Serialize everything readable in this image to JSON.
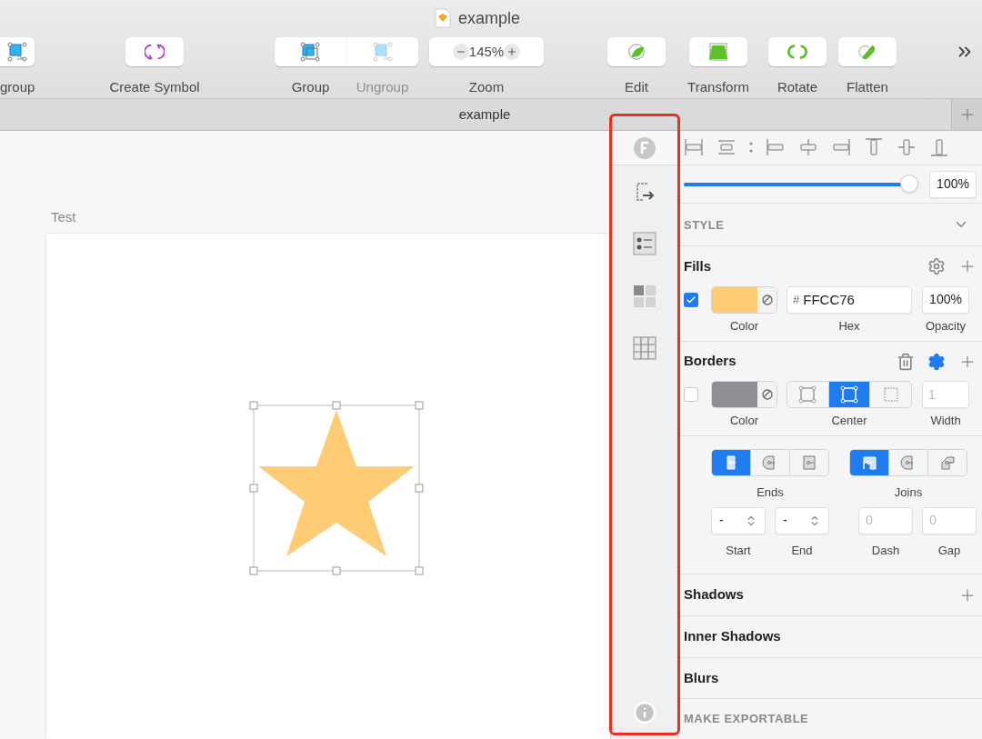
{
  "window": {
    "title": "example"
  },
  "toolbar": [
    {
      "kind": "ungroup",
      "label": "group",
      "disabled": false
    },
    {
      "kind": "symbol",
      "label": "Create Symbol",
      "disabled": false
    },
    {
      "kind": "pair",
      "segments": [
        {
          "kind": "group",
          "label": "Group",
          "disabled": false
        },
        {
          "kind": "ungroup",
          "label": "Ungroup",
          "disabled": true
        }
      ]
    },
    {
      "kind": "zoom",
      "label": "Zoom",
      "value": "145%",
      "disabled": false
    },
    {
      "kind": "edit",
      "label": "Edit",
      "disabled": false
    },
    {
      "kind": "transform",
      "label": "Transform",
      "disabled": false
    },
    {
      "kind": "rotate",
      "label": "Rotate",
      "disabled": false
    },
    {
      "kind": "flatten",
      "label": "Flatten",
      "disabled": false
    }
  ],
  "document_tab": {
    "label": "example"
  },
  "canvas": {
    "artboard_title": "Test",
    "shape_selected": true
  },
  "inspector": {
    "opacity": {
      "level": 1,
      "value": "100%"
    },
    "style": {
      "title": "STYLE",
      "expanded": true
    },
    "fills": {
      "title": "Fills",
      "items": [
        {
          "enabled": true,
          "hash": "#",
          "hex": "FFCC76",
          "opacity": "100%"
        }
      ],
      "labels": [
        "Color",
        "Hex",
        "Opacity"
      ]
    },
    "borders": {
      "title": "Borders",
      "items": [
        {
          "enabled": false,
          "positions": [
            {
              "kind": "inside",
              "selected": false
            },
            {
              "kind": "center",
              "selected": true
            },
            {
              "kind": "outside",
              "selected": false
            }
          ],
          "width_placeholder": "1"
        }
      ],
      "labels": [
        "Color",
        "Center",
        "Width"
      ]
    },
    "ends": {
      "label": "Ends",
      "options": [
        {
          "kind": "butt",
          "selected": true
        },
        {
          "kind": "round",
          "selected": false
        },
        {
          "kind": "square",
          "selected": false
        }
      ]
    },
    "joins": {
      "label": "Joins",
      "options": [
        {
          "kind": "miter",
          "selected": true
        },
        {
          "kind": "round",
          "selected": false
        },
        {
          "kind": "bevel",
          "selected": false
        }
      ]
    },
    "arrows": [
      {
        "label": "Start",
        "value": "-"
      },
      {
        "label": "End",
        "value": "-"
      }
    ],
    "dash": [
      {
        "label": "Dash",
        "placeholder": "0"
      },
      {
        "label": "Gap",
        "placeholder": "0"
      }
    ],
    "sections": [
      {
        "title": "Shadows",
        "addable": true
      },
      {
        "title": "Inner Shadows",
        "addable": false
      },
      {
        "title": "Blurs",
        "addable": false
      }
    ],
    "export": {
      "title": "MAKE EXPORTABLE"
    }
  }
}
